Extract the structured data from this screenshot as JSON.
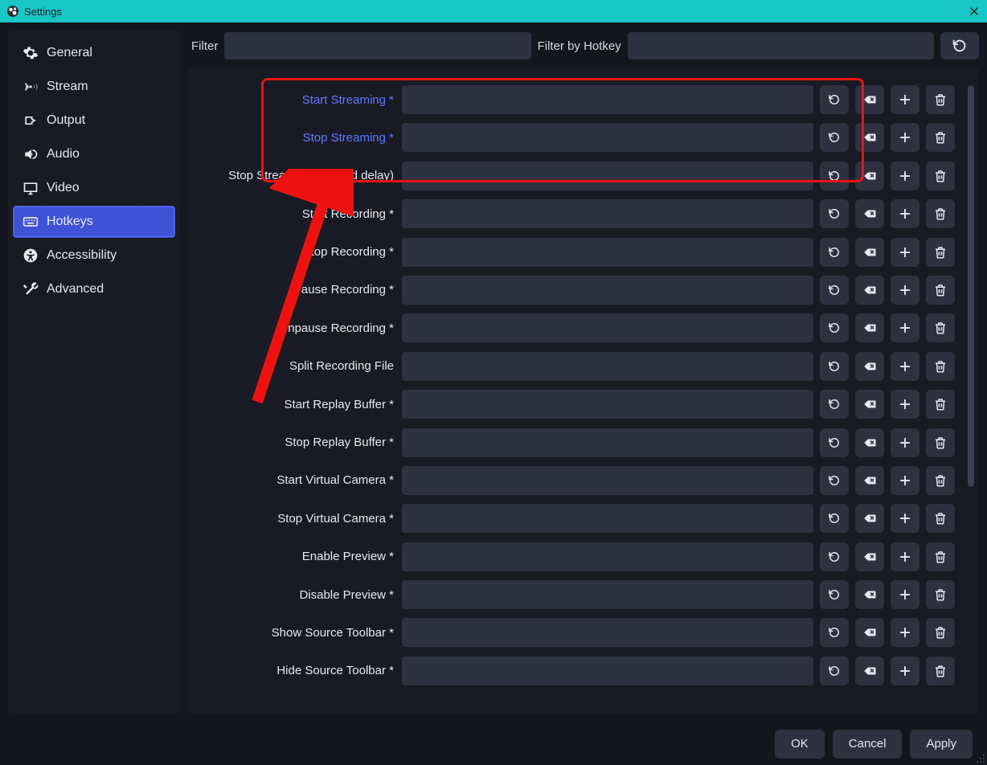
{
  "titlebar": {
    "title": "Settings"
  },
  "sidebar": {
    "items": [
      {
        "label": "General",
        "icon": "gear-icon"
      },
      {
        "label": "Stream",
        "icon": "broadcast-icon"
      },
      {
        "label": "Output",
        "icon": "output-icon"
      },
      {
        "label": "Audio",
        "icon": "audio-icon"
      },
      {
        "label": "Video",
        "icon": "monitor-icon"
      },
      {
        "label": "Hotkeys",
        "icon": "keyboard-icon"
      },
      {
        "label": "Accessibility",
        "icon": "accessibility-icon"
      },
      {
        "label": "Advanced",
        "icon": "tools-icon"
      }
    ],
    "active_index": 5
  },
  "filters": {
    "filter_label": "Filter",
    "filter_value": "",
    "hotkey_filter_label": "Filter by Hotkey",
    "hotkey_filter_value": ""
  },
  "hotkeys": [
    {
      "label": "Start Streaming *",
      "value": "",
      "highlight": true
    },
    {
      "label": "Stop Streaming *",
      "value": "",
      "highlight": true
    },
    {
      "label": "Stop Streaming (discard delay)",
      "value": ""
    },
    {
      "label": "Start Recording *",
      "value": ""
    },
    {
      "label": "Stop Recording *",
      "value": ""
    },
    {
      "label": "Pause Recording *",
      "value": ""
    },
    {
      "label": "Unpause Recording *",
      "value": ""
    },
    {
      "label": "Split Recording File",
      "value": ""
    },
    {
      "label": "Start Replay Buffer *",
      "value": ""
    },
    {
      "label": "Stop Replay Buffer *",
      "value": ""
    },
    {
      "label": "Start Virtual Camera *",
      "value": ""
    },
    {
      "label": "Stop Virtual Camera *",
      "value": ""
    },
    {
      "label": "Enable Preview *",
      "value": ""
    },
    {
      "label": "Disable Preview *",
      "value": ""
    },
    {
      "label": "Show Source Toolbar *",
      "value": ""
    },
    {
      "label": "Hide Source Toolbar *",
      "value": ""
    }
  ],
  "footer": {
    "ok": "OK",
    "cancel": "Cancel",
    "apply": "Apply"
  },
  "colors": {
    "accent": "#3d53d6",
    "titlebar": "#19c6c6",
    "highlight_text": "#6178ff"
  }
}
